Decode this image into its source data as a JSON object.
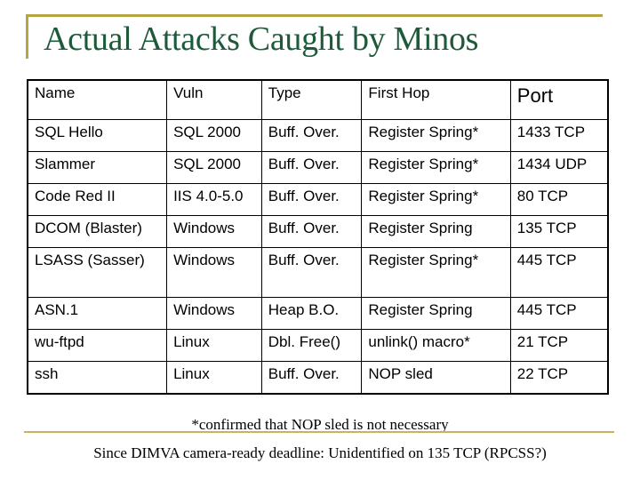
{
  "title": "Actual Attacks Caught by Minos",
  "table": {
    "headers": [
      "Name",
      "Vuln",
      "Type",
      "First Hop",
      "Port"
    ],
    "rows": [
      [
        "SQL Hello",
        "SQL 2000",
        "Buff. Over.",
        "Register Spring*",
        "1433 TCP"
      ],
      [
        "Slammer",
        "SQL 2000",
        "Buff. Over.",
        "Register Spring*",
        "1434 UDP"
      ],
      [
        "Code Red II",
        "IIS 4.0-5.0",
        "Buff. Over.",
        "Register Spring*",
        "80 TCP"
      ],
      [
        "DCOM (Blaster)",
        "Windows",
        "Buff. Over.",
        "Register Spring",
        "135 TCP"
      ],
      [
        "LSASS (Sasser)",
        "Windows",
        "Buff. Over.",
        "Register Spring*",
        "445 TCP"
      ],
      [
        "ASN.1",
        "Windows",
        "Heap B.O.",
        "Register Spring",
        "445 TCP"
      ],
      [
        "wu-ftpd",
        "Linux",
        "Dbl. Free()",
        "unlink() macro*",
        "21 TCP"
      ],
      [
        "ssh",
        "Linux",
        "Buff. Over.",
        "NOP sled",
        "22 TCP"
      ]
    ]
  },
  "footnote": "*confirmed that NOP sled is not necessary",
  "deadline_note": "Since DIMVA camera-ready deadline: Unidentified on 135 TCP (RPCSS?)",
  "colors": {
    "title": "#1d5a3a",
    "accent_gold": "#b5a642"
  }
}
